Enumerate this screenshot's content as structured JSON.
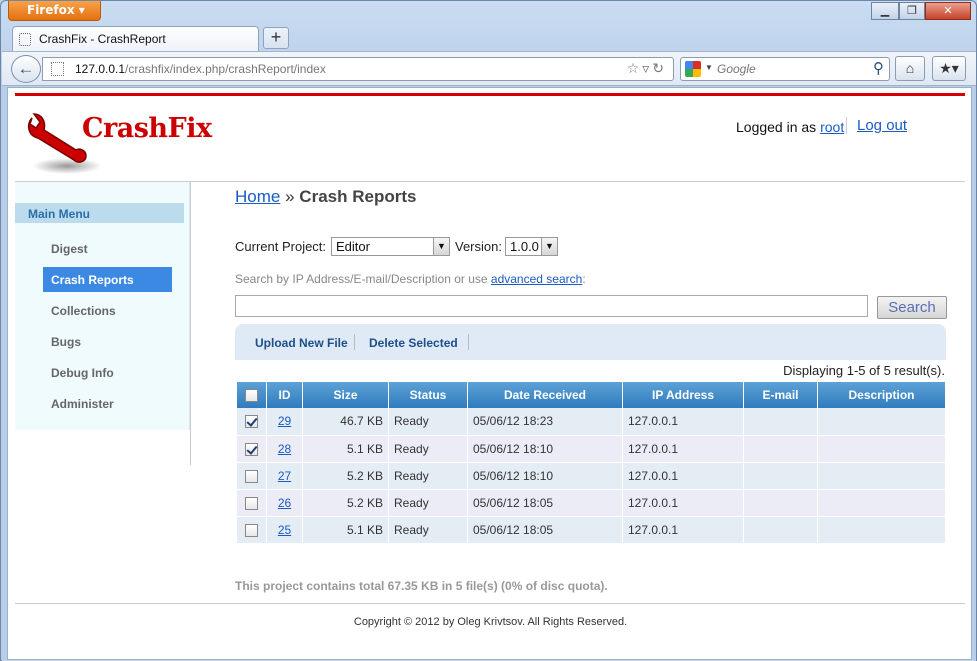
{
  "browser": {
    "menu_button": "Firefox",
    "tab_title": "CrashFix - CrashReport",
    "url_host": "127.0.0.1",
    "url_path": "/crashfix/index.php/crashReport/index",
    "search_placeholder": "Google"
  },
  "header": {
    "logo_text": "CrashFix",
    "logged_in_prefix": "Logged in as",
    "username": "root",
    "logout": "Log out"
  },
  "sidebar": {
    "heading": "Main Menu",
    "items": [
      "Digest",
      "Crash Reports",
      "Collections",
      "Bugs",
      "Debug Info",
      "Administer"
    ],
    "active": "Crash Reports"
  },
  "breadcrumb": {
    "home": "Home",
    "separator": "»",
    "current": "Crash Reports"
  },
  "filters": {
    "project_label": "Current Project:",
    "project_value": "Editor",
    "version_label": "Version:",
    "version_value": "1.0.0",
    "search_hint": "Search by IP Address/E-mail/Description or use",
    "advanced_link": "advanced search",
    "hint_suffix": ":",
    "search_button": "Search"
  },
  "actions": {
    "upload": "Upload New File",
    "delete": "Delete Selected"
  },
  "results_text": "Displaying 1-5 of 5 result(s).",
  "table": {
    "columns": [
      "ID",
      "Size",
      "Status",
      "Date Received",
      "IP Address",
      "E-mail",
      "Description"
    ],
    "rows": [
      {
        "checked": true,
        "id": "29",
        "size": "46.7 KB",
        "status": "Ready",
        "date": "05/06/12 18:23",
        "ip": "127.0.0.1",
        "email": "",
        "description": ""
      },
      {
        "checked": true,
        "id": "28",
        "size": "5.1 KB",
        "status": "Ready",
        "date": "05/06/12 18:10",
        "ip": "127.0.0.1",
        "email": "",
        "description": ""
      },
      {
        "checked": false,
        "id": "27",
        "size": "5.2 KB",
        "status": "Ready",
        "date": "05/06/12 18:10",
        "ip": "127.0.0.1",
        "email": "",
        "description": ""
      },
      {
        "checked": false,
        "id": "26",
        "size": "5.2 KB",
        "status": "Ready",
        "date": "05/06/12 18:05",
        "ip": "127.0.0.1",
        "email": "",
        "description": ""
      },
      {
        "checked": false,
        "id": "25",
        "size": "5.1 KB",
        "status": "Ready",
        "date": "05/06/12 18:05",
        "ip": "127.0.0.1",
        "email": "",
        "description": ""
      }
    ]
  },
  "summary": "This project contains total 67.35 KB in 5 file(s) (0% of disc quota).",
  "footer": "Copyright © 2012 by Oleg Krivtsov. All Rights Reserved."
}
